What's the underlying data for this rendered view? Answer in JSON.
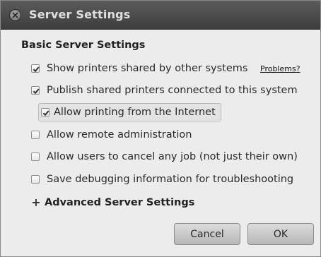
{
  "window": {
    "title": "Server Settings"
  },
  "basic": {
    "heading": "Basic Server Settings",
    "problems_link": "Problems?",
    "options": [
      {
        "label": "Show printers shared by other systems",
        "checked": true
      },
      {
        "label": "Publish shared printers connected to this system",
        "checked": true
      },
      {
        "label": "Allow printing from the Internet",
        "checked": true
      },
      {
        "label": "Allow remote administration",
        "checked": false
      },
      {
        "label": "Allow users to cancel any job (not just their own)",
        "checked": false
      },
      {
        "label": "Save debugging information for troubleshooting",
        "checked": false
      }
    ]
  },
  "advanced": {
    "expander_symbol": "+",
    "label": "Advanced Server Settings"
  },
  "buttons": {
    "cancel": "Cancel",
    "ok": "OK"
  },
  "icons": {
    "close": "close-icon",
    "check": "checkmark-icon",
    "expand": "plus-icon"
  }
}
